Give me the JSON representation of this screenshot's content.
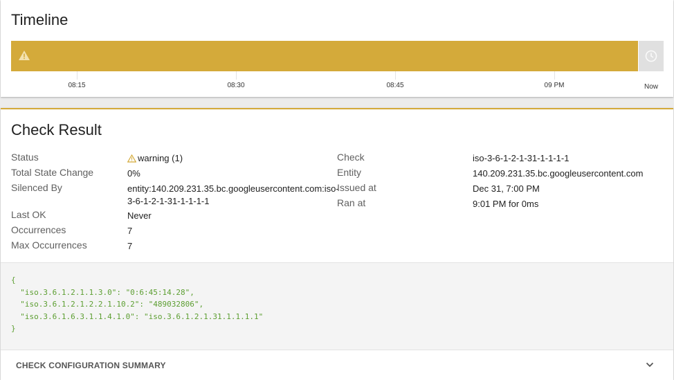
{
  "timeline": {
    "title": "Timeline",
    "status_color": "#d4aa3a",
    "status_icon": "warning-icon",
    "now_icon": "clock-icon",
    "ticks": [
      "08:15",
      "08:30",
      "08:45",
      "09 PM"
    ],
    "now_label": "Now"
  },
  "check_result": {
    "title": "Check Result",
    "status_label": "Status",
    "status_value": "warning (1)",
    "total_state_change_label": "Total State Change",
    "total_state_change_value": "0%",
    "silenced_by_label": "Silenced By",
    "silenced_by_value_line1": "entity:140.209.231.35.bc.googleusercontent.com:iso-",
    "silenced_by_value_line2": "3-6-1-2-1-31-1-1-1-1",
    "last_ok_label": "Last OK",
    "last_ok_value": "Never",
    "occurrences_label": "Occurrences",
    "occurrences_value": "7",
    "max_occurrences_label": "Max Occurrences",
    "max_occurrences_value": "7",
    "check_label": "Check",
    "check_value": "iso-3-6-1-2-1-31-1-1-1-1",
    "entity_label": "Entity",
    "entity_value": "140.209.231.35.bc.googleusercontent.com",
    "issued_at_label": "Issued at",
    "issued_at_value": "Dec 31, 7:00 PM",
    "ran_at_label": "Ran at",
    "ran_at_value": "9:01 PM for 0ms",
    "output": "{\n  \"iso.3.6.1.2.1.1.3.0\": \"0:6:45:14.28\",\n  \"iso.3.6.1.2.1.2.2.1.10.2\": \"489032806\",\n  \"iso.3.6.1.6.3.1.1.4.1.0\": \"iso.3.6.1.2.1.31.1.1.1.1\"\n}",
    "summary_label": "CHECK CONFIGURATION SUMMARY",
    "summary_icon": "chevron-down-icon"
  }
}
